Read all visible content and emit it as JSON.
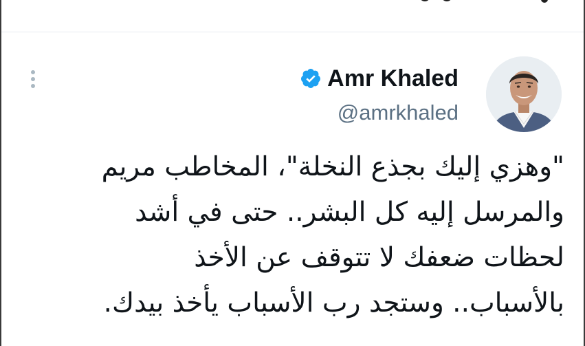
{
  "tweet": {
    "author": {
      "display_name": "Amr Khaled",
      "handle": "@amrkhaled",
      "verified": true
    },
    "text_lines": [
      "\"وهزي إليك بجذع النخلة\"، المخاطب مريم",
      "والمرسل إليه كل البشر.. حتى في أشد",
      "لحظات ضعفك لا تتوقف عن الأخذ",
      "بالأسباب.. وستجد رب الأسباب يأخذ بيدك."
    ]
  },
  "icons": {
    "more": "more-vertical-icon",
    "verified": "verified-badge-icon"
  },
  "colors": {
    "verified_blue": "#1da1f2",
    "handle_gray": "#5b7083",
    "divider": "#e6ecf0",
    "text": "#0f1419",
    "more_dots": "#aab8c2"
  }
}
